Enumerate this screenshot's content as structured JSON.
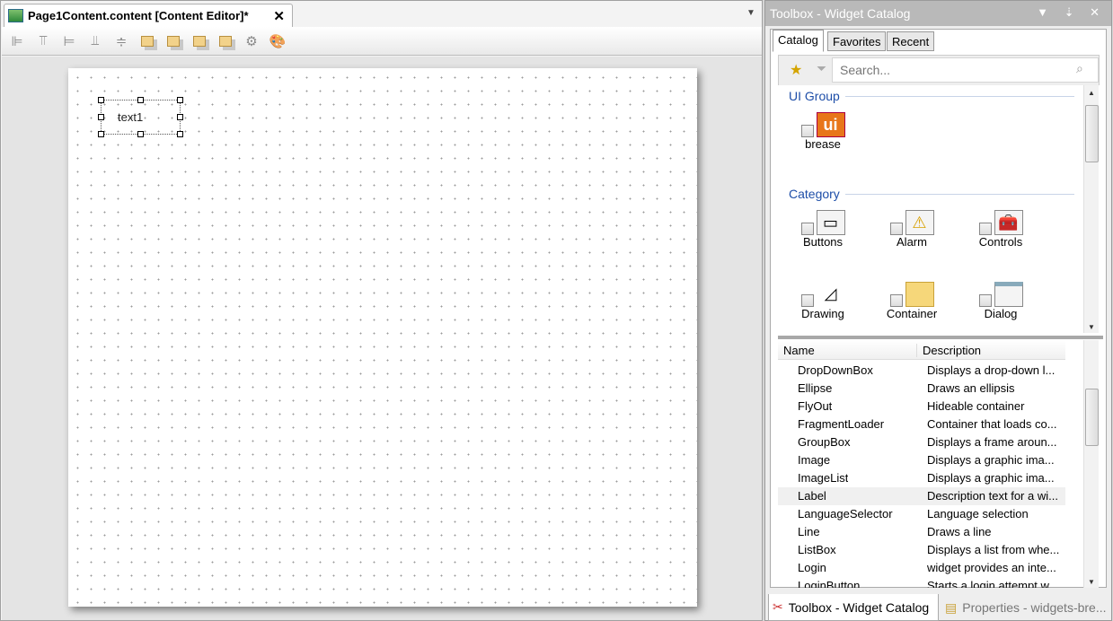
{
  "editor": {
    "tab_title": "Page1Content.content [Content Editor]*",
    "close": "✕",
    "menu": "▼",
    "toolbar": [
      {
        "name": "align-left-icon",
        "g": "⊫"
      },
      {
        "name": "align-top-icon",
        "g": "⫪"
      },
      {
        "name": "align-right-icon",
        "g": "⊨"
      },
      {
        "name": "align-bottom-icon",
        "g": "⫫"
      },
      {
        "name": "center-icon",
        "g": "≑"
      },
      {
        "name": "bring-front-icon"
      },
      {
        "name": "send-back-icon"
      },
      {
        "name": "bring-forward-icon"
      },
      {
        "name": "send-backward-icon"
      },
      {
        "name": "settings-gear-icon",
        "g": "⚙"
      },
      {
        "name": "palette-icon",
        "g": "🎨"
      }
    ],
    "widget_text": "text1"
  },
  "toolbox": {
    "title": "Toolbox - Widget Catalog",
    "controls": "▼ ⇣ ✕",
    "tabs": [
      "Catalog",
      "Favorites",
      "Recent"
    ],
    "search_placeholder": "Search...",
    "ui_group": {
      "label": "UI Group",
      "items": [
        "brease"
      ]
    },
    "category": {
      "label": "Category",
      "items": [
        "Buttons",
        "Alarm",
        "Controls",
        "Drawing",
        "Container",
        "Dialog"
      ]
    },
    "list": {
      "columns": [
        "Name",
        "Description"
      ],
      "rows": [
        [
          "DropDownBox",
          "Displays a drop-down l..."
        ],
        [
          "Ellipse",
          "Draws an ellipsis"
        ],
        [
          "FlyOut",
          "Hideable container"
        ],
        [
          "FragmentLoader",
          "Container that loads co..."
        ],
        [
          "GroupBox",
          "Displays a frame aroun..."
        ],
        [
          "Image",
          "Displays a graphic ima..."
        ],
        [
          "ImageList",
          "Displays a graphic ima..."
        ],
        [
          "Label",
          "Description text for a wi..."
        ],
        [
          "LanguageSelector",
          "Language selection"
        ],
        [
          "Line",
          "Draws a line"
        ],
        [
          "ListBox",
          "Displays a list from whe..."
        ],
        [
          "Login",
          "widget provides an inte..."
        ],
        [
          "LoginButton",
          "Starts a login attempt w..."
        ]
      ],
      "selected": "Label"
    }
  },
  "bottom_tabs": [
    "Toolbox - Widget Catalog",
    "Properties - widgets-bre..."
  ]
}
